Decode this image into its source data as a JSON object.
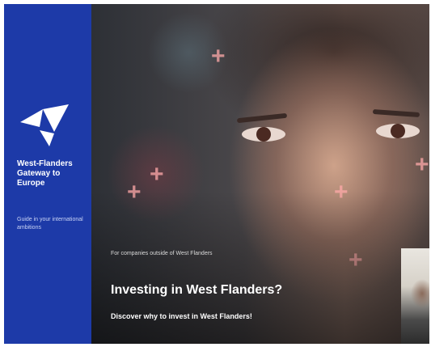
{
  "sidebar": {
    "brand_title": "West-Flanders Gateway to Europe",
    "brand_tagline": "Guide in your international ambitions",
    "logo_icon": "west-flanders-logo-icon",
    "background": "#1d3aa8"
  },
  "hero": {
    "subheading": "For companies outside of West Flanders",
    "title": "Investing in West Flanders?",
    "cta": "Discover why to invest in West Flanders!"
  },
  "thumbnail": {
    "icon": "person-photo-thumbnail"
  }
}
